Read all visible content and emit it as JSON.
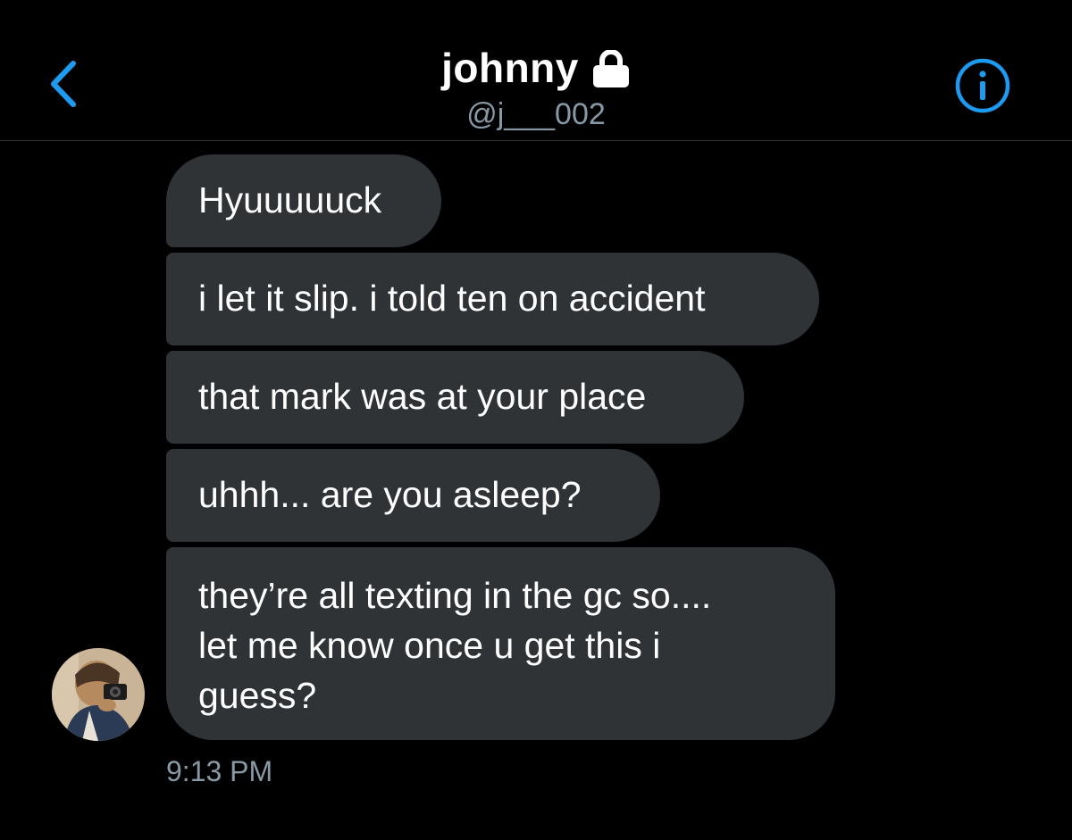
{
  "header": {
    "name": "johnny",
    "handle": "@j___002",
    "back_icon": "chevron-left-icon",
    "lock_icon": "lock-icon",
    "info_icon": "info-icon",
    "accent_color": "#1d9bf0"
  },
  "conversation": {
    "messages": [
      {
        "text": "Hyuuuuuck"
      },
      {
        "text": "i let it slip. i told ten on accident"
      },
      {
        "text": "that mark was at your place"
      },
      {
        "text": "uhhh... are you asleep?"
      },
      {
        "text": "they’re all texting in the gc so....\nlet me know once u get this i\nguess?"
      }
    ],
    "timestamp": "9:13 PM",
    "bubble_color": "#2f3336"
  }
}
